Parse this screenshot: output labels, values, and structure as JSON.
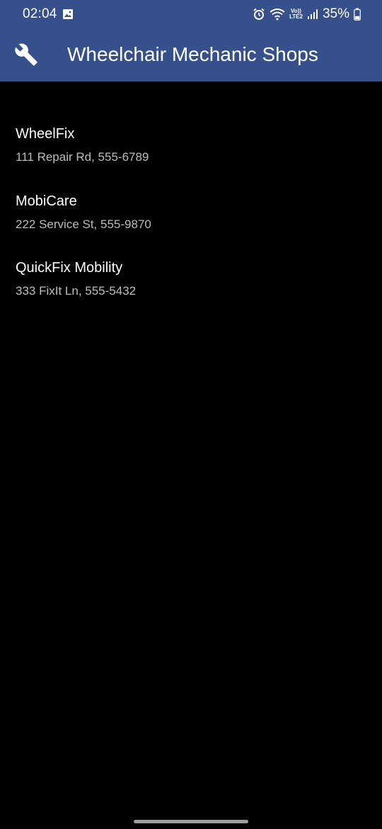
{
  "status_bar": {
    "time": "02:04",
    "network_top": "Vo))",
    "network_bottom": "LTE2",
    "battery_percent": "35%",
    "battery_level": 0.35,
    "icons": [
      "gallery-icon",
      "alarm-icon",
      "wifi-icon",
      "signal-icon",
      "battery-icon"
    ]
  },
  "app_bar": {
    "icon": "wrench-icon",
    "title": "Wheelchair Mechanic Shops",
    "color": "#35508a"
  },
  "shops": [
    {
      "name": "WheelFix",
      "detail": "111 Repair Rd, 555-6789"
    },
    {
      "name": "MobiCare",
      "detail": "222 Service St, 555-9870"
    },
    {
      "name": "QuickFix Mobility",
      "detail": "333 FixIt Ln, 555-5432"
    }
  ],
  "colors": {
    "background": "#000000",
    "primary_text": "#ffffff",
    "secondary_text": "#bdbdbd"
  }
}
